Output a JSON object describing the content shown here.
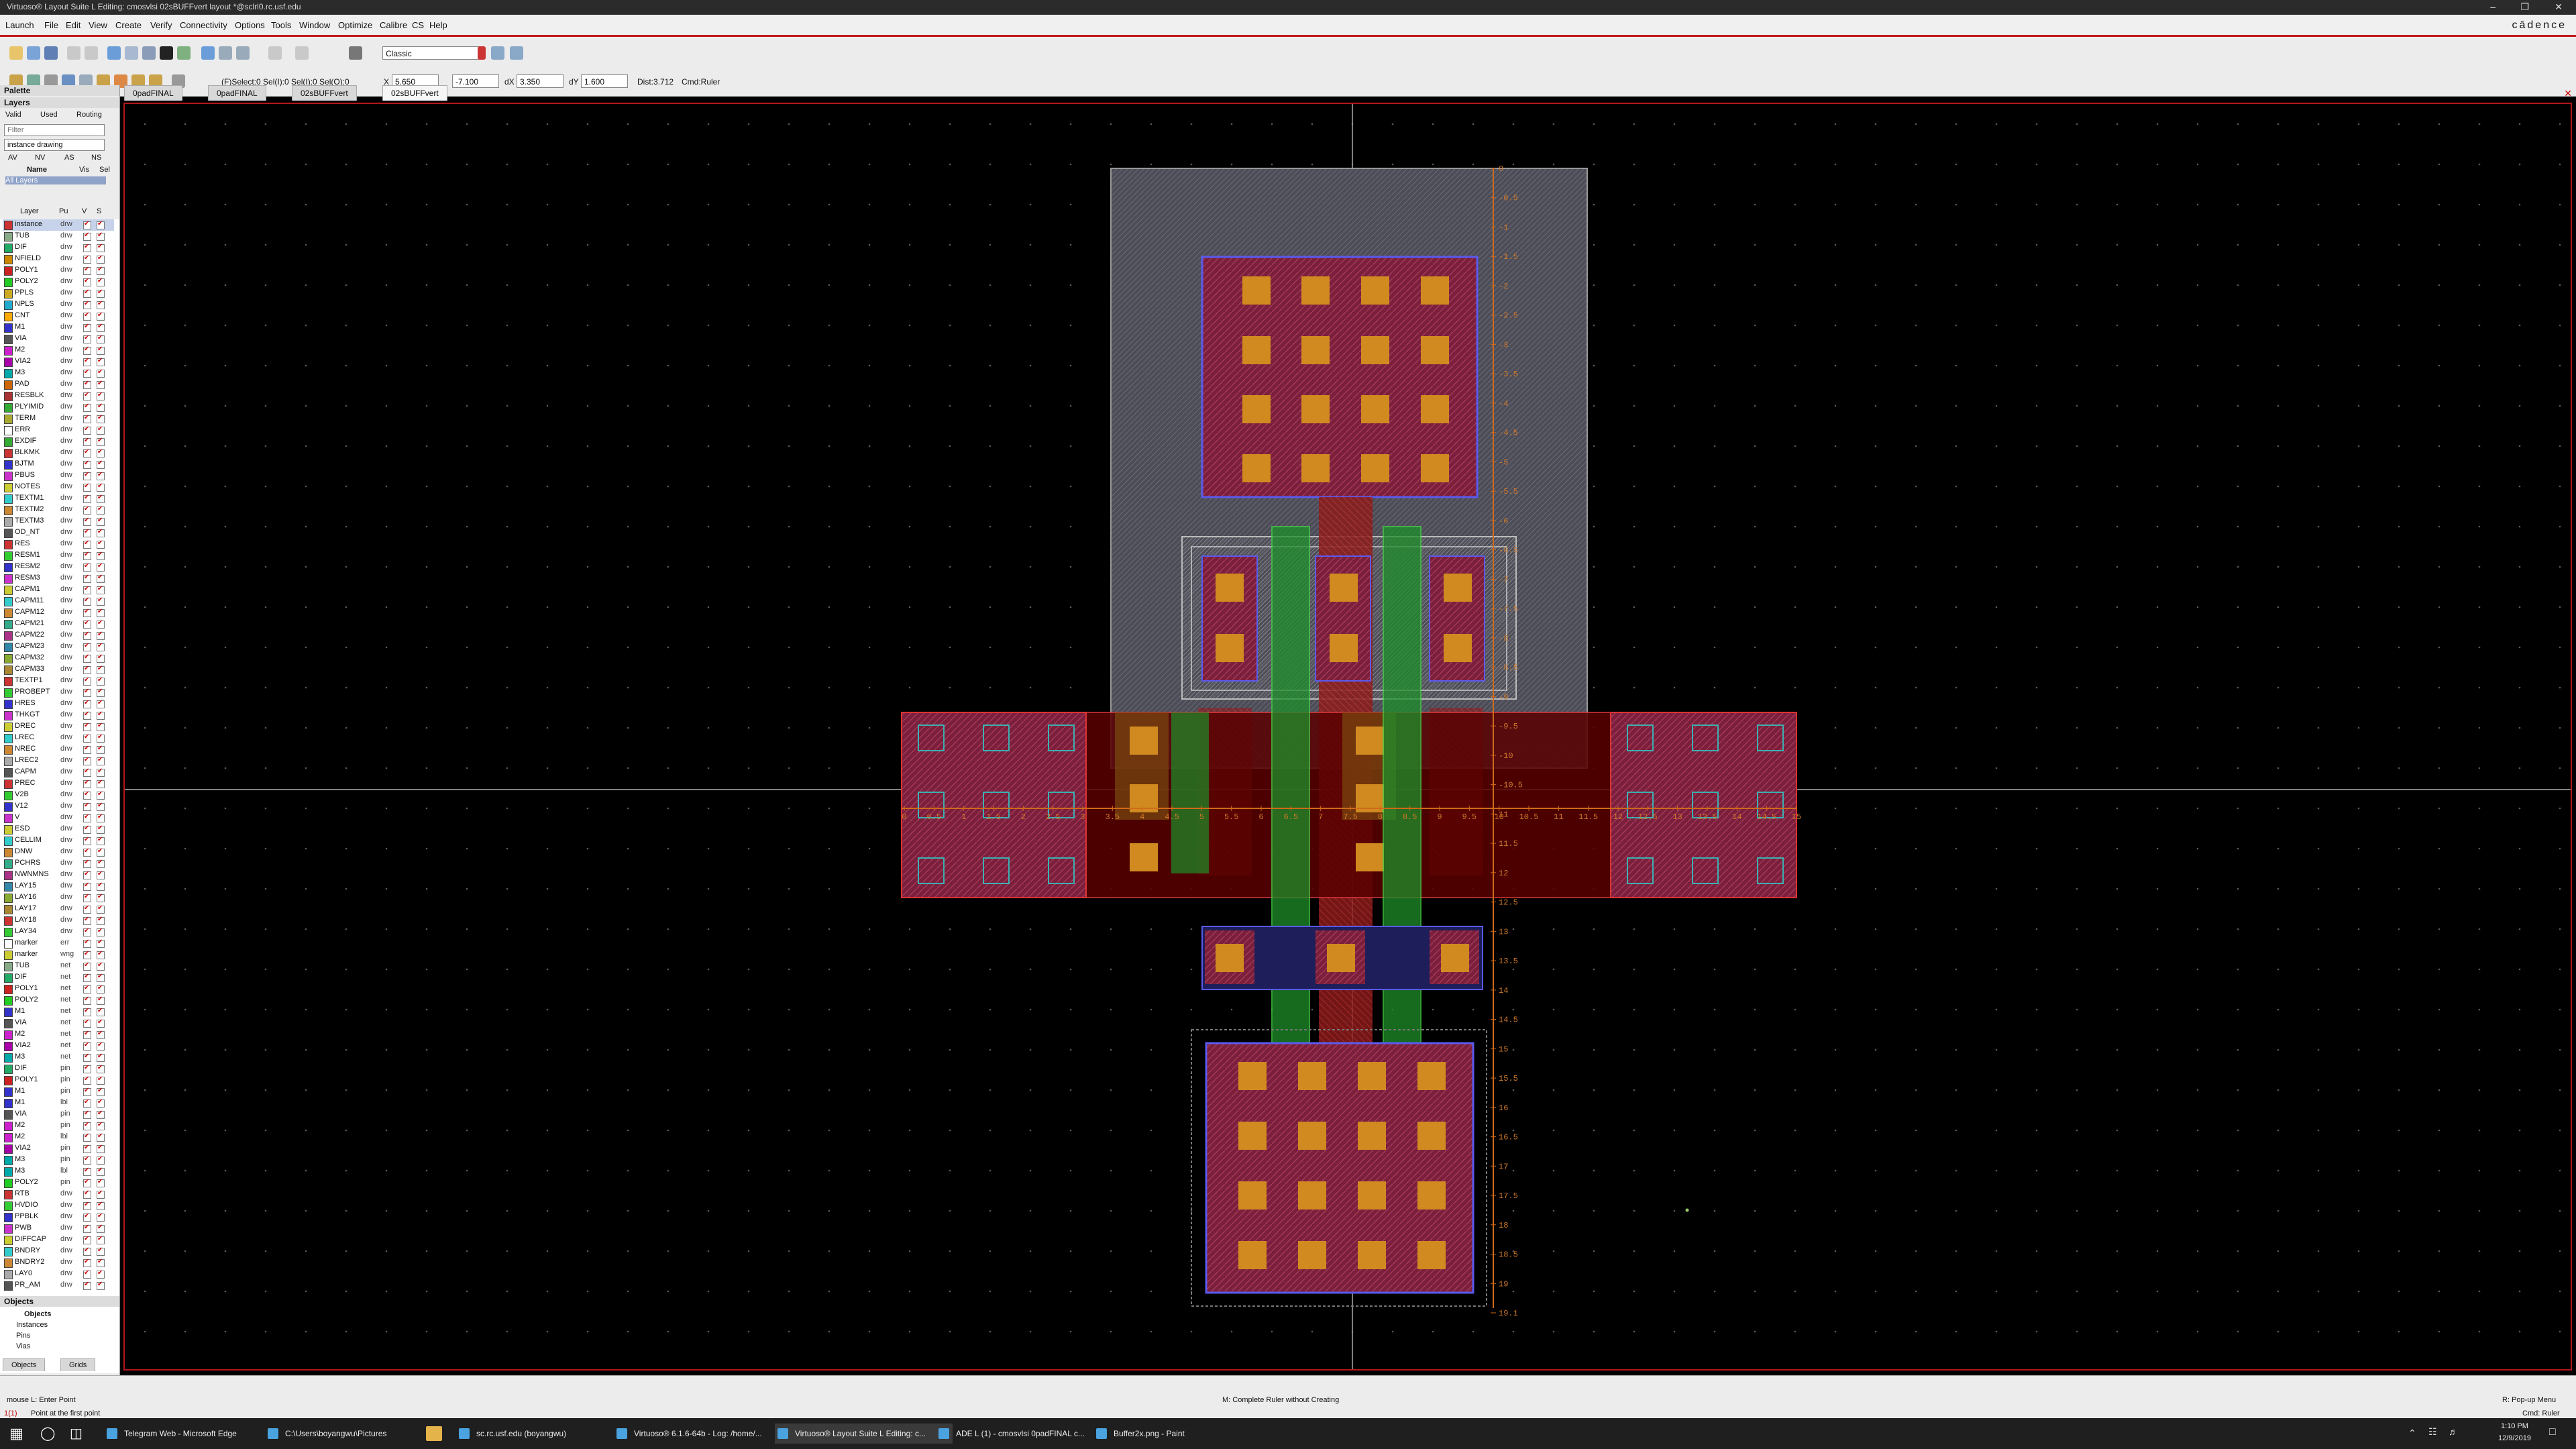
{
  "window": {
    "title": "Virtuoso® Layout Suite L Editing: cmosvlsi 02sBUFFvert layout *@sclrl0.rc.usf.edu",
    "brand": "cādence"
  },
  "menus": [
    "Launch",
    "File",
    "Edit",
    "View",
    "Create",
    "Verify",
    "Connectivity",
    "Options",
    "Tools",
    "Window",
    "Optimize",
    "Calibre",
    "CS",
    "Help"
  ],
  "toolbar": {
    "workspace": "Classic",
    "select_counts": "(F)Select:0   Sel(I):0   Sel(I):0   Sel(O):0",
    "x_label": "X",
    "x_value": "5.650",
    "y_value": "-7.100",
    "dx_label": "dX",
    "dx_value": "3.350",
    "dy_label": "dY",
    "dy_value": "1.600",
    "dist": "Dist:3.712",
    "cmd": "Cmd:Ruler"
  },
  "tabs": [
    "0padFINAL",
    "0padFINAL",
    "02sBUFFvert",
    "02sBUFFvert"
  ],
  "palette": {
    "title": "Palette",
    "layers_header": "Layers",
    "filters": [
      "Valid",
      "Used",
      "Routing"
    ],
    "filter_placeholder": "Filter",
    "lpp_current": "instance drawing",
    "vis_buttons": [
      "AV",
      "NV",
      "AS",
      "NS"
    ],
    "name_cols": [
      "Name",
      "Vis",
      "Sel"
    ],
    "all_layers": "All Layers",
    "list_cols": [
      "Layer",
      "Pu",
      "V",
      "S"
    ],
    "layers": [
      {
        "n": "instance",
        "p": "drw",
        "c": "#c33"
      },
      {
        "n": "TUB",
        "p": "drw",
        "c": "#8a8"
      },
      {
        "n": "DIF",
        "p": "drw",
        "c": "#2a6"
      },
      {
        "n": "NFIELD",
        "p": "drw",
        "c": "#c80"
      },
      {
        "n": "POLY1",
        "p": "drw",
        "c": "#c22"
      },
      {
        "n": "POLY2",
        "p": "drw",
        "c": "#2c2"
      },
      {
        "n": "PPLS",
        "p": "drw",
        "c": "#ca2"
      },
      {
        "n": "NPLS",
        "p": "drw",
        "c": "#2ac"
      },
      {
        "n": "CNT",
        "p": "drw",
        "c": "#fa0"
      },
      {
        "n": "M1",
        "p": "drw",
        "c": "#33c"
      },
      {
        "n": "VIA",
        "p": "drw",
        "c": "#555"
      },
      {
        "n": "M2",
        "p": "drw",
        "c": "#c2c"
      },
      {
        "n": "VIA2",
        "p": "drw",
        "c": "#a0a"
      },
      {
        "n": "M3",
        "p": "drw",
        "c": "#0aa"
      },
      {
        "n": "PAD",
        "p": "drw",
        "c": "#c60"
      },
      {
        "n": "RESBLK",
        "p": "drw",
        "c": "#a33"
      },
      {
        "n": "PLYIMID",
        "p": "drw",
        "c": "#3a3"
      },
      {
        "n": "TERM",
        "p": "drw",
        "c": "#aa3"
      },
      {
        "n": "ERR",
        "p": "drw",
        "c": "#fff"
      },
      {
        "n": "EXDIF",
        "p": "drw",
        "c": "#3a3"
      },
      {
        "n": "BLKMK",
        "p": "drw",
        "c": "#c33"
      },
      {
        "n": "BJTM",
        "p": "drw",
        "c": "#33c"
      },
      {
        "n": "PBUS",
        "p": "drw",
        "c": "#c3c"
      },
      {
        "n": "NOTES",
        "p": "drw",
        "c": "#cc3"
      },
      {
        "n": "TEXTM1",
        "p": "drw",
        "c": "#3cc"
      },
      {
        "n": "TEXTM2",
        "p": "drw",
        "c": "#c83"
      },
      {
        "n": "TEXTM3",
        "p": "drw",
        "c": "#aaa"
      },
      {
        "n": "OD_NT",
        "p": "drw",
        "c": "#555"
      },
      {
        "n": "RES",
        "p": "drw",
        "c": "#c33"
      },
      {
        "n": "RESM1",
        "p": "drw",
        "c": "#3c3"
      },
      {
        "n": "RESM2",
        "p": "drw",
        "c": "#33c"
      },
      {
        "n": "RESM3",
        "p": "drw",
        "c": "#c3c"
      },
      {
        "n": "CAPM1",
        "p": "drw",
        "c": "#cc3"
      },
      {
        "n": "CAPM11",
        "p": "drw",
        "c": "#3cc"
      },
      {
        "n": "CAPM12",
        "p": "drw",
        "c": "#c83"
      },
      {
        "n": "CAPM21",
        "p": "drw",
        "c": "#3a8"
      },
      {
        "n": "CAPM22",
        "p": "drw",
        "c": "#a38"
      },
      {
        "n": "CAPM23",
        "p": "drw",
        "c": "#38a"
      },
      {
        "n": "CAPM32",
        "p": "drw",
        "c": "#8a3"
      },
      {
        "n": "CAPM33",
        "p": "drw",
        "c": "#a83"
      },
      {
        "n": "TEXTP1",
        "p": "drw",
        "c": "#c33"
      },
      {
        "n": "PROBEPT",
        "p": "drw",
        "c": "#3c3"
      },
      {
        "n": "HRES",
        "p": "drw",
        "c": "#33c"
      },
      {
        "n": "THKGT",
        "p": "drw",
        "c": "#c3c"
      },
      {
        "n": "DREC",
        "p": "drw",
        "c": "#cc3"
      },
      {
        "n": "LREC",
        "p": "drw",
        "c": "#3cc"
      },
      {
        "n": "NREC",
        "p": "drw",
        "c": "#c83"
      },
      {
        "n": "LREC2",
        "p": "drw",
        "c": "#aaa"
      },
      {
        "n": "CAPM",
        "p": "drw",
        "c": "#555"
      },
      {
        "n": "PREC",
        "p": "drw",
        "c": "#c33"
      },
      {
        "n": "V2B",
        "p": "drw",
        "c": "#3c3"
      },
      {
        "n": "V12",
        "p": "drw",
        "c": "#33c"
      },
      {
        "n": "V",
        "p": "drw",
        "c": "#c3c"
      },
      {
        "n": "ESD",
        "p": "drw",
        "c": "#cc3"
      },
      {
        "n": "CELLIM",
        "p": "drw",
        "c": "#3cc"
      },
      {
        "n": "DNW",
        "p": "drw",
        "c": "#c83"
      },
      {
        "n": "PCHRS",
        "p": "drw",
        "c": "#3a8"
      },
      {
        "n": "NWNMNS",
        "p": "drw",
        "c": "#a38"
      },
      {
        "n": "LAY15",
        "p": "drw",
        "c": "#38a"
      },
      {
        "n": "LAY16",
        "p": "drw",
        "c": "#8a3"
      },
      {
        "n": "LAY17",
        "p": "drw",
        "c": "#a83"
      },
      {
        "n": "LAY18",
        "p": "drw",
        "c": "#c33"
      },
      {
        "n": "LAY34",
        "p": "drw",
        "c": "#3c3"
      },
      {
        "n": "marker",
        "p": "err",
        "c": "#fff"
      },
      {
        "n": "marker",
        "p": "wng",
        "c": "#cc3"
      },
      {
        "n": "TUB",
        "p": "net",
        "c": "#8a8"
      },
      {
        "n": "DIF",
        "p": "net",
        "c": "#2a6"
      },
      {
        "n": "POLY1",
        "p": "net",
        "c": "#c22"
      },
      {
        "n": "POLY2",
        "p": "net",
        "c": "#2c2"
      },
      {
        "n": "M1",
        "p": "net",
        "c": "#33c"
      },
      {
        "n": "VIA",
        "p": "net",
        "c": "#555"
      },
      {
        "n": "M2",
        "p": "net",
        "c": "#c2c"
      },
      {
        "n": "VIA2",
        "p": "net",
        "c": "#a0a"
      },
      {
        "n": "M3",
        "p": "net",
        "c": "#0aa"
      },
      {
        "n": "DIF",
        "p": "pin",
        "c": "#2a6"
      },
      {
        "n": "POLY1",
        "p": "pin",
        "c": "#c22"
      },
      {
        "n": "M1",
        "p": "pin",
        "c": "#33c"
      },
      {
        "n": "M1",
        "p": "lbl",
        "c": "#33c"
      },
      {
        "n": "VIA",
        "p": "pin",
        "c": "#555"
      },
      {
        "n": "M2",
        "p": "pin",
        "c": "#c2c"
      },
      {
        "n": "M2",
        "p": "lbl",
        "c": "#c2c"
      },
      {
        "n": "VIA2",
        "p": "pin",
        "c": "#a0a"
      },
      {
        "n": "M3",
        "p": "pin",
        "c": "#0aa"
      },
      {
        "n": "M3",
        "p": "lbl",
        "c": "#0aa"
      },
      {
        "n": "POLY2",
        "p": "pin",
        "c": "#2c2"
      },
      {
        "n": "RTB",
        "p": "drw",
        "c": "#c33"
      },
      {
        "n": "HVDIO",
        "p": "drw",
        "c": "#3c3"
      },
      {
        "n": "PPBLK",
        "p": "drw",
        "c": "#33c"
      },
      {
        "n": "PWB",
        "p": "drw",
        "c": "#c3c"
      },
      {
        "n": "DIFFCAP",
        "p": "drw",
        "c": "#cc3"
      },
      {
        "n": "BNDRY",
        "p": "drw",
        "c": "#3cc"
      },
      {
        "n": "BNDRY2",
        "p": "drw",
        "c": "#c83"
      },
      {
        "n": "LAY0",
        "p": "drw",
        "c": "#aaa"
      },
      {
        "n": "PR_AM",
        "p": "drw",
        "c": "#555"
      }
    ],
    "objects_header": "Objects",
    "objects_title": "Objects",
    "objects": [
      "Instances",
      "Pins",
      "Vias"
    ],
    "bottom_tabs": [
      "Objects",
      "Grids"
    ]
  },
  "rulers": {
    "vertical_labels": [
      "0",
      "-0.5",
      "-1",
      "-1.5",
      "-2",
      "-2.5",
      "-3",
      "-3.5",
      "-4",
      "-4.5",
      "-5",
      "-5.5",
      "-6",
      "-6.5",
      "-7",
      "-7.5",
      "-8",
      "-8.5",
      "-9",
      "-9.5",
      "-10",
      "-10.5",
      "11",
      "11.5",
      "12",
      "12.5",
      "13",
      "13.5",
      "14",
      "14.5",
      "15",
      "15.5",
      "16",
      "16.5",
      "17",
      "17.5",
      "18",
      "18.5",
      "19",
      "19.1"
    ],
    "horizontal_labels": [
      "0",
      "0.5",
      "1",
      "1.5",
      "2",
      "2.5",
      "3",
      "3.5",
      "4",
      "4.5",
      "5",
      "5.5",
      "6",
      "6.5",
      "7",
      "7.5",
      "8",
      "8.5",
      "9",
      "9.5",
      "10",
      "10.5",
      "11",
      "11.5",
      "12",
      "12.5",
      "13",
      "13.5",
      "14",
      "14.5",
      "15"
    ]
  },
  "status": {
    "mouse_left": "mouse L: Enter Point",
    "mouse_mid": "M: Complete Ruler without Creating",
    "mouse_right": "R: Pop-up Menu",
    "prompt_num": "1(1)",
    "prompt": "Point at the first point",
    "cmd": "Cmd: Ruler"
  },
  "taskbar": {
    "items": [
      "Telegram Web - Microsoft Edge",
      "C:\\Users\\boyangwu\\Pictures",
      "",
      "sc.rc.usf.edu (boyangwu)",
      "Virtuoso® 6.1.6-64b - Log: /home/...",
      "Virtuoso® Layout Suite L Editing: c...",
      "ADE L (1) - cmosvlsi 0padFINAL c...",
      "Buffer2x.png - Paint"
    ],
    "time": "1:10 PM",
    "date": "12/9/2019"
  }
}
